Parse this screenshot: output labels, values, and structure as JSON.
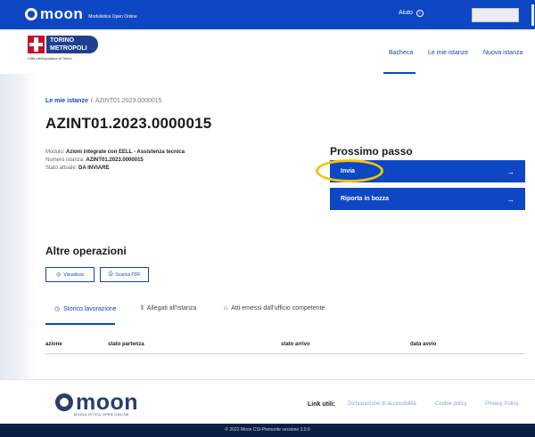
{
  "topbar": {
    "logo_word": "moon",
    "logo_subtitle": "Modulistica Open Online",
    "help_label": "Aiuto",
    "help_icon": "question-circle-icon"
  },
  "header": {
    "brand_line1": "TORINO",
    "brand_line2": "METROPOLI",
    "brand_sub": "Città metropolitana di Torino",
    "nav": [
      "Bacheca",
      "Le mie istanze",
      "Nuova istanza"
    ]
  },
  "breadcrumb": {
    "parent": "Le mie istanze",
    "separator": "/",
    "current": "AZINT01.2023.0000015"
  },
  "page_title": "AZINT01.2023.0000015",
  "info": {
    "modulo_label": "Modulo:",
    "modulo_value": "Azioni integrate con EELL - Assistenza tecnica",
    "numero_label": "Numero istanza:",
    "numero_value": "AZINT01.2023.0000015",
    "stato_label": "Stato attuale:",
    "stato_value": "DA INVIARE"
  },
  "next_step": {
    "title": "Prossimo passo",
    "actions": [
      {
        "label": "Invia",
        "icon": "arrow-right-icon",
        "arrow": "→"
      },
      {
        "label": "Riporta in bozza",
        "icon": "arrow-right-icon",
        "arrow": "→"
      }
    ]
  },
  "other_ops": {
    "title": "Altre operazioni",
    "buttons": [
      {
        "label": "Visualizza",
        "icon": "eye-icon",
        "glyph": "◎"
      },
      {
        "label": "Scarica PDF",
        "icon": "download-icon",
        "glyph": "⎙"
      }
    ]
  },
  "tabs": [
    {
      "label": "Storico lavorazione",
      "icon": "clock-icon",
      "glyph": "◷"
    },
    {
      "label": "Allegati all'istanza",
      "icon": "paperclip-icon",
      "glyph": "⎙"
    },
    {
      "label": "Atti emessi dall'ufficio competente",
      "icon": "institution-icon",
      "glyph": "⌂"
    }
  ],
  "table": {
    "columns": [
      "azione",
      "stato partenza",
      "stato arrivo",
      "data avvio"
    ]
  },
  "footer": {
    "logo_word": "moon",
    "logo_subtitle": "MODULISTICA OPEN ONLINE",
    "links_label": "Link utili:",
    "links": [
      "Dichiarazione di accessibilità",
      "Cookie policy",
      "Privacy Policy"
    ],
    "copyright": "© 2022 Moon CSI-Piemonte versione 3.0.0"
  },
  "colors": {
    "primary": "#0d47c4",
    "highlight": "#f5c400",
    "footer_dark": "#0b1f44"
  }
}
